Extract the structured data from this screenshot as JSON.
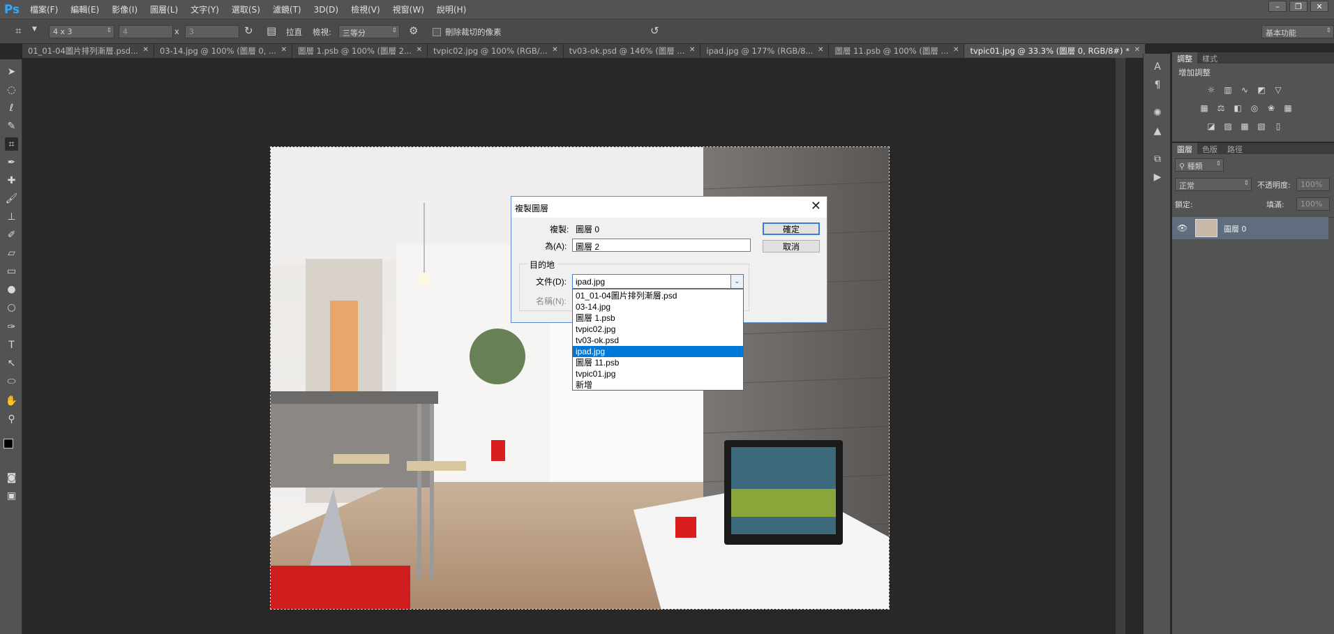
{
  "menubar": {
    "logo": "Ps",
    "items": [
      "檔案(F)",
      "編輯(E)",
      "影像(I)",
      "圖層(L)",
      "文字(Y)",
      "選取(S)",
      "濾鏡(T)",
      "3D(D)",
      "檢視(V)",
      "視窗(W)",
      "說明(H)"
    ],
    "window_controls": [
      "–",
      "❐",
      "✕"
    ]
  },
  "options_bar": {
    "ratio_value": "4 x 3",
    "width_value": "4",
    "height_value": "3",
    "x_separator": "x",
    "straighten_label": "拉直",
    "view_label": "檢視:",
    "view_value": "三等分",
    "delete_cropped_label": "刪除裁切的像素",
    "workspace_value": "基本功能"
  },
  "tabs": [
    {
      "label": "01_01-04圖片排列漸層.psd..."
    },
    {
      "label": "03-14.jpg @ 100% (圖層 0, ..."
    },
    {
      "label": "圖層 1.psb @ 100% (圖層 2..."
    },
    {
      "label": "tvpic02.jpg @ 100% (RGB/..."
    },
    {
      "label": "tv03-ok.psd @ 146% (圖層 ..."
    },
    {
      "label": "ipad.jpg @ 177% (RGB/8..."
    },
    {
      "label": "圖層 11.psb @ 100% (圖層 ..."
    },
    {
      "label": "tvpic01.jpg @ 33.3% (圖層 0, RGB/8#) *"
    }
  ],
  "right_panels": {
    "adjust_tabs": [
      "調整",
      "樣式"
    ],
    "add_adjust_label": "增加調整",
    "layers_tabs": [
      "圖層",
      "色版",
      "路徑"
    ],
    "kind_filter": "種類",
    "blend_mode": "正常",
    "opacity_label": "不透明度:",
    "opacity_value": "100%",
    "lock_label": "鎖定:",
    "fill_label": "填滿:",
    "fill_value": "100%",
    "layer_name": "圖層 0"
  },
  "dialog": {
    "title": "複製圖層",
    "duplicate_label": "複製:",
    "duplicate_value": "圖層 0",
    "as_label": "為(A):",
    "as_value": "圖層 2",
    "ok_label": "確定",
    "cancel_label": "取消",
    "destination_legend": "目的地",
    "document_label": "文件(D):",
    "document_value": "ipad.jpg",
    "name_label": "名稱(N):"
  },
  "dropdown": {
    "items": [
      "01_01-04圖片排列漸層.psd",
      "03-14.jpg",
      "圖層 1.psb",
      "tvpic02.jpg",
      "tv03-ok.psd",
      "ipad.jpg",
      "圖層 11.psb",
      "tvpic01.jpg",
      "新增"
    ],
    "selected_index": 5
  },
  "colors": {
    "app_bg": "#282828",
    "panel_bg": "#535353",
    "accent": "#0078d7",
    "ps_blue": "#31a8ff"
  }
}
